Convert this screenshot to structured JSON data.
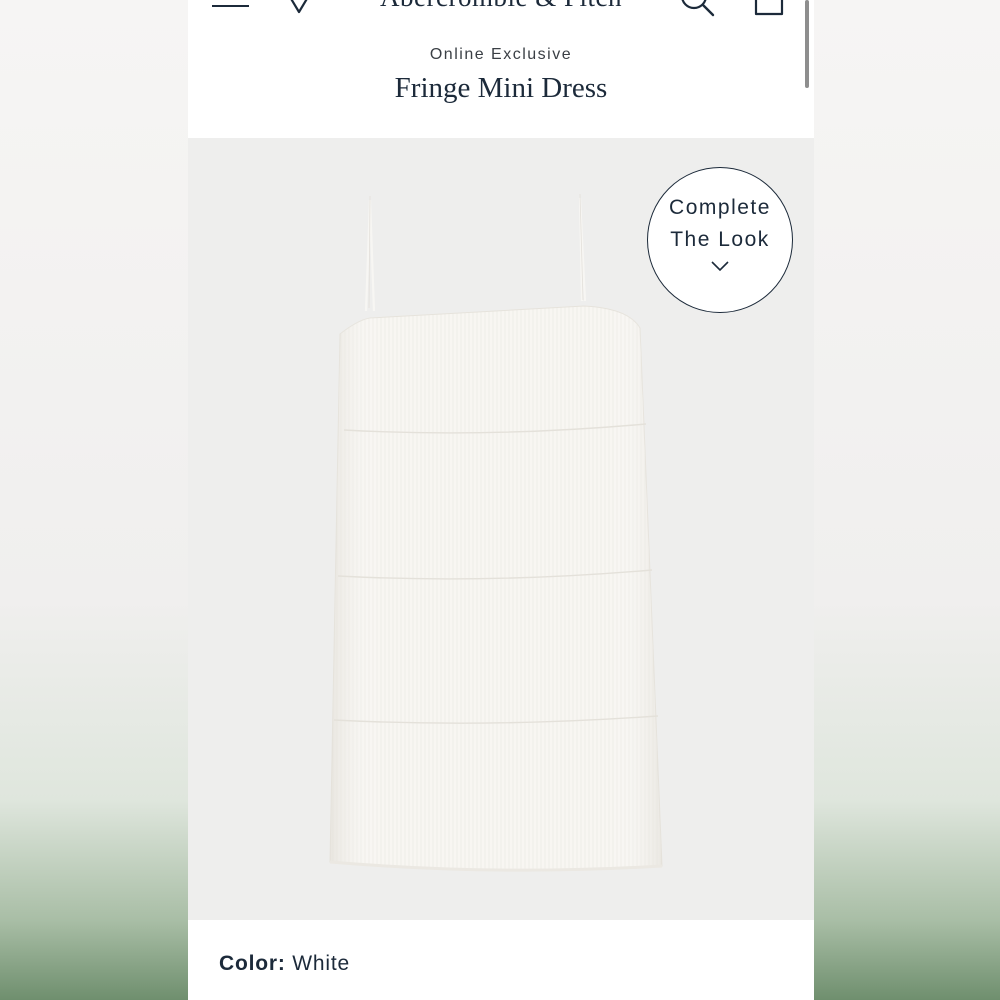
{
  "header": {
    "brand_logo": "Abercrombie & Fitch",
    "icons": [
      "menu-icon",
      "heart-icon",
      "search-icon",
      "bag-icon"
    ]
  },
  "product": {
    "eyebrow": "Online Exclusive",
    "title": "Fringe Mini Dress",
    "complete_the_look": {
      "line1": "Complete",
      "line2": "The Look",
      "icon": "chevron-down-icon"
    },
    "color": {
      "label": "Color:",
      "value": "White"
    }
  },
  "colors": {
    "text_primary": "#1c2a3a",
    "image_background": "#eeeeed",
    "page_background": "#ffffff"
  }
}
